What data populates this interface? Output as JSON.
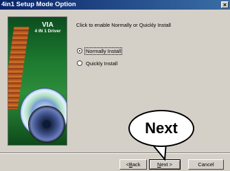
{
  "window": {
    "title": "4in1 Setup Mode Option",
    "close_label": "×"
  },
  "banner": {
    "title": "VIA",
    "subtitle": "4 IN 1 Driver"
  },
  "main": {
    "instruction": "Click to enable Normally or Quickly Install",
    "options": [
      {
        "label": "Normally Install",
        "selected": true
      },
      {
        "label": "Quickly Install",
        "selected": false
      }
    ]
  },
  "buttons": {
    "back": {
      "prefix": "< ",
      "mnemonic": "B",
      "rest": "ack"
    },
    "next": {
      "mnemonic": "N",
      "rest": "ext >"
    },
    "cancel": "Cancel"
  },
  "callout": {
    "text": "Next"
  },
  "colors": {
    "titlebar_start": "#0a246a",
    "titlebar_end": "#3a6ea5",
    "dialog_face": "#d4d0c8"
  }
}
